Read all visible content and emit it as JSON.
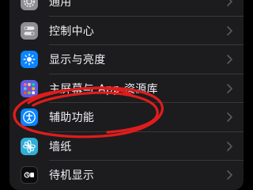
{
  "settings_list": {
    "items": [
      {
        "id": "general",
        "label": "通用",
        "icon": "gear-icon",
        "icon_color": "#8e8e93"
      },
      {
        "id": "control-center",
        "label": "控制中心",
        "icon": "toggles-icon",
        "icon_color": "#8e8e93"
      },
      {
        "id": "display-brightness",
        "label": "显示与亮度",
        "icon": "sun-icon",
        "icon_color": "#0a84ff"
      },
      {
        "id": "home-screen",
        "label": "主屏幕与 App 资源库",
        "icon": "app-grid-icon",
        "icon_color": "#5e5ce6"
      },
      {
        "id": "accessibility",
        "label": "辅助功能",
        "icon": "accessibility-icon",
        "icon_color": "#0a84ff"
      },
      {
        "id": "wallpaper",
        "label": "墙纸",
        "icon": "flower-icon",
        "icon_color": "#30b0d8"
      },
      {
        "id": "standby",
        "label": "待机显示",
        "icon": "standby-icon",
        "icon_color": "#1c1c1e"
      }
    ]
  },
  "annotation": {
    "shape": "hand-drawn-circle",
    "color": "#e01c1c"
  }
}
